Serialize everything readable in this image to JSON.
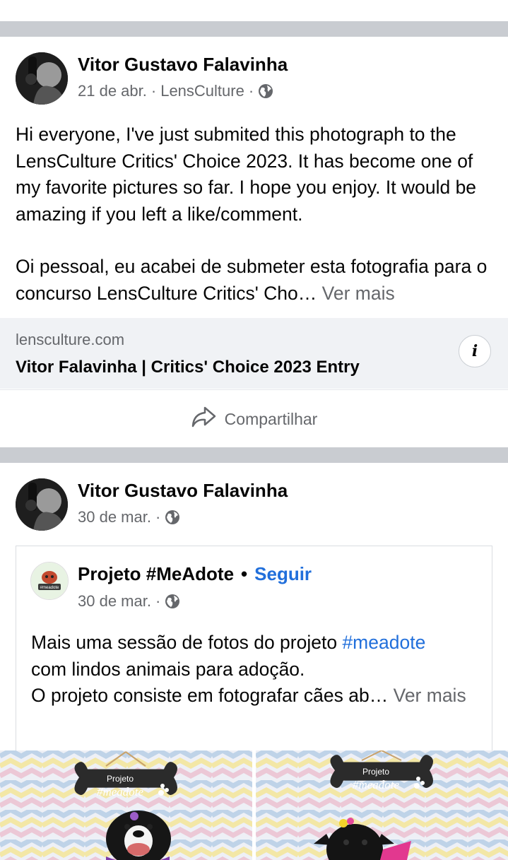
{
  "post1": {
    "author": "Vitor Gustavo Falavinha",
    "date": "21 de abr.",
    "separator": "·",
    "source": "LensCulture",
    "text_en": "Hi everyone, I've just submited this photograph to the LensCulture Critics' Choice 2023. It has become one of my favorite pictures so far. I hope you enjoy. It would be amazing if you left a like/comment.",
    "text_pt": "Oi pessoal, eu acabei de submeter esta fotografia para o concurso LensCulture Critics' Cho…",
    "see_more": "Ver mais",
    "link": {
      "domain": "lensculture.com",
      "title": "Vitor Falavinha | Critics' Choice 2023 Entry",
      "info_label": "i"
    },
    "share_label": "Compartilhar"
  },
  "post2": {
    "author": "Vitor Gustavo Falavinha",
    "date": "30 de mar.",
    "separator": "·",
    "shared": {
      "page_name": "Projeto #MeAdote",
      "dot": "•",
      "follow_label": "Seguir",
      "date": "30 de mar.",
      "separator": "·",
      "text_before_tag": "Mais uma sessão de fotos do projeto ",
      "hashtag": "#meadote",
      "text_line2": "com lindos animais para adoção.",
      "text_line3": "O projeto consiste em fotografar cães ab…",
      "see_more": "Ver mais",
      "avatar_text": "#meadote"
    },
    "photos": [
      {
        "sign_line1": "Projeto",
        "sign_line2": "#meadote"
      },
      {
        "sign_line1": "Projeto",
        "sign_line2": "#meadote"
      }
    ]
  },
  "colors": {
    "divider": "#c9ccd1",
    "link_bg": "#f0f2f5",
    "secondary_text": "#65676b",
    "accent_blue": "#216fdb"
  },
  "icons": {
    "globe": "globe-icon",
    "share": "share-arrow-icon",
    "info": "info-icon"
  }
}
